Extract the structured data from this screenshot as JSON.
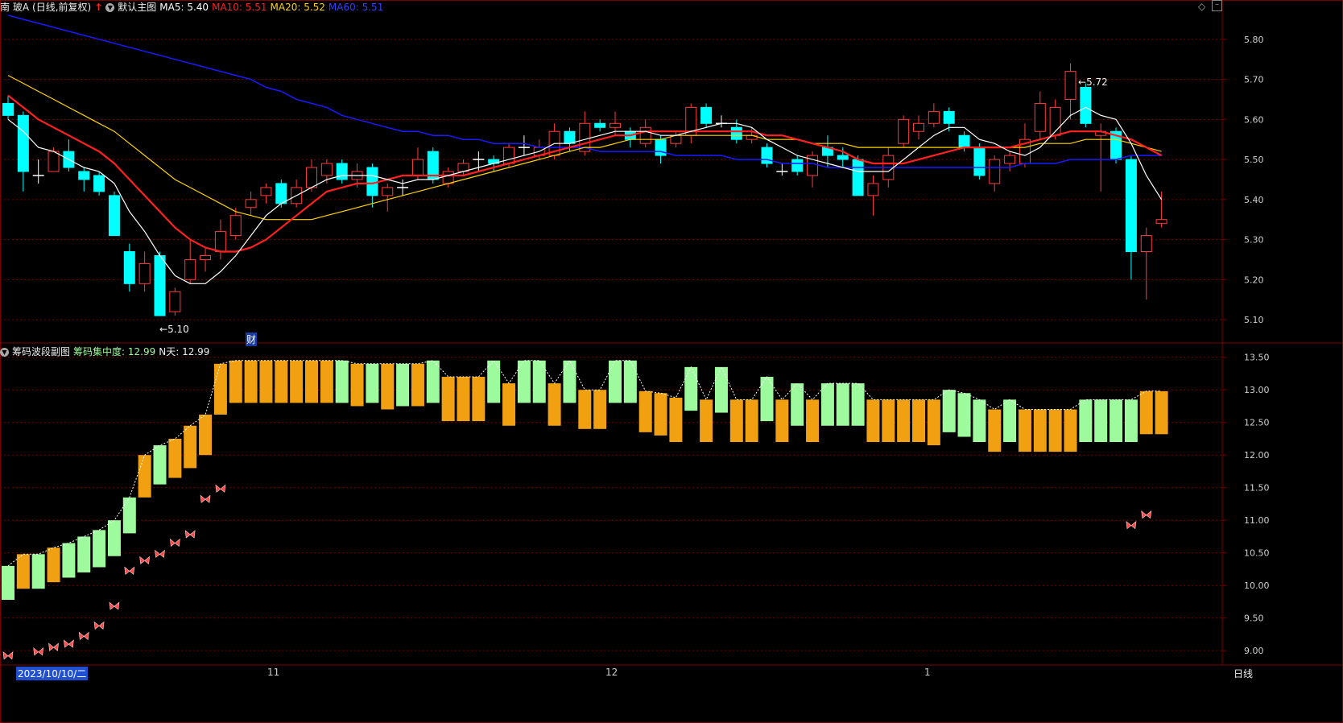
{
  "colors": {
    "up": "#ff3b3b",
    "down": "#00ffff",
    "ma5": "#ffffff",
    "ma10": "#ff2020",
    "ma20": "#ffd400",
    "ma60": "#1a1aff",
    "grid": "#7a0000",
    "chip_up": "#9dfb9d",
    "chip_down": "#f0a010",
    "axis_text": "#d0d0d0"
  },
  "header": {
    "stock": "南 玻A",
    "period": "(日线,前复权)",
    "template": "默认主图",
    "ma5": "MA5: 5.40",
    "ma10": "MA10: 5.51",
    "ma20": "MA20: 5.52",
    "ma60": "MA60: 5.51"
  },
  "sub_header": {
    "name": "筹码波段副图",
    "concentration": "筹码集中度: 12.99",
    "ndays": "N天: 12.99"
  },
  "annotations": {
    "high": "5.72",
    "low": "5.10",
    "fin": "财"
  },
  "xaxis": {
    "labels": [
      "2023/10/10/二",
      "11",
      "12",
      "1"
    ],
    "period_button": "日线"
  },
  "icons": [
    "arrow-up-icon",
    "chevron-down-icon",
    "diamond-icon",
    "minimize-icon"
  ],
  "chart_data": [
    {
      "type": "candlestick",
      "ylim": [
        5.07,
        5.87
      ],
      "yticks": [
        5.1,
        5.2,
        5.3,
        5.4,
        5.5,
        5.6,
        5.7,
        5.8
      ],
      "candles": [
        [
          5.64,
          5.61,
          5.66,
          5.6
        ],
        [
          5.61,
          5.47,
          5.62,
          5.42
        ],
        [
          5.46,
          5.46,
          5.5,
          5.44
        ],
        [
          5.47,
          5.52,
          5.53,
          5.47
        ],
        [
          5.52,
          5.48,
          5.55,
          5.47
        ],
        [
          5.47,
          5.45,
          5.48,
          5.42
        ],
        [
          5.46,
          5.42,
          5.47,
          5.41
        ],
        [
          5.41,
          5.31,
          5.42,
          5.31
        ],
        [
          5.27,
          5.19,
          5.29,
          5.17
        ],
        [
          5.19,
          5.24,
          5.27,
          5.17
        ],
        [
          5.26,
          5.11,
          5.27,
          5.11
        ],
        [
          5.12,
          5.17,
          5.18,
          5.11
        ],
        [
          5.2,
          5.25,
          5.3,
          5.19
        ],
        [
          5.25,
          5.26,
          5.28,
          5.22
        ],
        [
          5.27,
          5.32,
          5.35,
          5.25
        ],
        [
          5.31,
          5.36,
          5.38,
          5.3
        ],
        [
          5.38,
          5.4,
          5.42,
          5.36
        ],
        [
          5.41,
          5.43,
          5.44,
          5.39
        ],
        [
          5.44,
          5.39,
          5.45,
          5.38
        ],
        [
          5.39,
          5.43,
          5.45,
          5.38
        ],
        [
          5.43,
          5.48,
          5.5,
          5.42
        ],
        [
          5.46,
          5.49,
          5.5,
          5.44
        ],
        [
          5.49,
          5.45,
          5.5,
          5.44
        ],
        [
          5.45,
          5.47,
          5.49,
          5.43
        ],
        [
          5.48,
          5.41,
          5.49,
          5.38
        ],
        [
          5.41,
          5.43,
          5.44,
          5.37
        ],
        [
          5.43,
          5.43,
          5.45,
          5.41
        ],
        [
          5.46,
          5.5,
          5.53,
          5.45
        ],
        [
          5.52,
          5.45,
          5.53,
          5.44
        ],
        [
          5.44,
          5.47,
          5.48,
          5.43
        ],
        [
          5.47,
          5.49,
          5.5,
          5.46
        ],
        [
          5.5,
          5.5,
          5.52,
          5.47
        ],
        [
          5.5,
          5.49,
          5.51,
          5.47
        ],
        [
          5.49,
          5.53,
          5.54,
          5.48
        ],
        [
          5.53,
          5.53,
          5.56,
          5.51
        ],
        [
          5.51,
          5.53,
          5.55,
          5.5
        ],
        [
          5.51,
          5.57,
          5.59,
          5.5
        ],
        [
          5.57,
          5.54,
          5.58,
          5.52
        ],
        [
          5.52,
          5.59,
          5.62,
          5.51
        ],
        [
          5.59,
          5.58,
          5.6,
          5.57
        ],
        [
          5.58,
          5.59,
          5.62,
          5.56
        ],
        [
          5.57,
          5.55,
          5.58,
          5.53
        ],
        [
          5.54,
          5.58,
          5.6,
          5.53
        ],
        [
          5.55,
          5.51,
          5.56,
          5.49
        ],
        [
          5.54,
          5.56,
          5.57,
          5.53
        ],
        [
          5.56,
          5.63,
          5.64,
          5.54
        ],
        [
          5.63,
          5.59,
          5.64,
          5.58
        ],
        [
          5.59,
          5.59,
          5.61,
          5.58
        ],
        [
          5.58,
          5.55,
          5.6,
          5.54
        ],
        [
          5.55,
          5.56,
          5.58,
          5.54
        ],
        [
          5.53,
          5.49,
          5.54,
          5.48
        ],
        [
          5.47,
          5.47,
          5.49,
          5.46
        ],
        [
          5.5,
          5.47,
          5.51,
          5.46
        ],
        [
          5.46,
          5.51,
          5.52,
          5.43
        ],
        [
          5.53,
          5.51,
          5.56,
          5.48
        ],
        [
          5.51,
          5.5,
          5.53,
          5.48
        ],
        [
          5.5,
          5.41,
          5.51,
          5.41
        ],
        [
          5.41,
          5.44,
          5.46,
          5.36
        ],
        [
          5.45,
          5.51,
          5.53,
          5.43
        ],
        [
          5.54,
          5.6,
          5.61,
          5.53
        ],
        [
          5.57,
          5.59,
          5.61,
          5.55
        ],
        [
          5.59,
          5.62,
          5.64,
          5.58
        ],
        [
          5.62,
          5.59,
          5.63,
          5.57
        ],
        [
          5.56,
          5.53,
          5.57,
          5.52
        ],
        [
          5.53,
          5.46,
          5.54,
          5.45
        ],
        [
          5.44,
          5.5,
          5.51,
          5.42
        ],
        [
          5.49,
          5.51,
          5.52,
          5.47
        ],
        [
          5.49,
          5.55,
          5.59,
          5.48
        ],
        [
          5.57,
          5.64,
          5.67,
          5.55
        ],
        [
          5.56,
          5.63,
          5.65,
          5.55
        ],
        [
          5.65,
          5.72,
          5.74,
          5.6
        ],
        [
          5.68,
          5.59,
          5.69,
          5.58
        ],
        [
          5.56,
          5.57,
          5.59,
          5.42
        ],
        [
          5.57,
          5.5,
          5.58,
          5.49
        ],
        [
          5.5,
          5.27,
          5.51,
          5.2
        ],
        [
          5.27,
          5.31,
          5.33,
          5.15
        ],
        [
          5.34,
          5.35,
          5.42,
          5.33
        ]
      ],
      "ma5": [
        5.6,
        5.57,
        5.53,
        5.52,
        5.5,
        5.48,
        5.47,
        5.44,
        5.37,
        5.32,
        5.26,
        5.21,
        5.19,
        5.19,
        5.22,
        5.26,
        5.31,
        5.36,
        5.39,
        5.41,
        5.43,
        5.45,
        5.46,
        5.46,
        5.46,
        5.45,
        5.44,
        5.45,
        5.45,
        5.46,
        5.47,
        5.48,
        5.49,
        5.5,
        5.51,
        5.52,
        5.54,
        5.54,
        5.55,
        5.56,
        5.57,
        5.57,
        5.57,
        5.56,
        5.56,
        5.57,
        5.58,
        5.59,
        5.59,
        5.58,
        5.55,
        5.53,
        5.51,
        5.5,
        5.49,
        5.48,
        5.47,
        5.47,
        5.47,
        5.5,
        5.53,
        5.56,
        5.58,
        5.58,
        5.55,
        5.54,
        5.52,
        5.51,
        5.53,
        5.57,
        5.61,
        5.63,
        5.61,
        5.6,
        5.54,
        5.46,
        5.4
      ],
      "ma10": [
        5.66,
        5.63,
        5.6,
        5.58,
        5.56,
        5.54,
        5.52,
        5.49,
        5.45,
        5.41,
        5.37,
        5.33,
        5.3,
        5.28,
        5.27,
        5.27,
        5.28,
        5.3,
        5.33,
        5.36,
        5.39,
        5.42,
        5.43,
        5.44,
        5.44,
        5.45,
        5.46,
        5.46,
        5.46,
        5.46,
        5.46,
        5.47,
        5.48,
        5.49,
        5.5,
        5.51,
        5.52,
        5.53,
        5.54,
        5.55,
        5.56,
        5.56,
        5.57,
        5.57,
        5.57,
        5.57,
        5.57,
        5.57,
        5.57,
        5.57,
        5.56,
        5.56,
        5.55,
        5.54,
        5.53,
        5.52,
        5.5,
        5.49,
        5.49,
        5.49,
        5.5,
        5.51,
        5.52,
        5.53,
        5.53,
        5.53,
        5.53,
        5.54,
        5.55,
        5.56,
        5.57,
        5.57,
        5.57,
        5.56,
        5.55,
        5.53,
        5.51
      ],
      "ma20": [
        5.71,
        5.69,
        5.67,
        5.65,
        5.63,
        5.61,
        5.59,
        5.57,
        5.54,
        5.51,
        5.48,
        5.45,
        5.43,
        5.41,
        5.39,
        5.37,
        5.36,
        5.35,
        5.35,
        5.35,
        5.35,
        5.36,
        5.37,
        5.38,
        5.39,
        5.4,
        5.41,
        5.42,
        5.43,
        5.44,
        5.45,
        5.46,
        5.47,
        5.48,
        5.49,
        5.5,
        5.51,
        5.52,
        5.53,
        5.53,
        5.54,
        5.55,
        5.55,
        5.55,
        5.56,
        5.56,
        5.56,
        5.56,
        5.56,
        5.56,
        5.55,
        5.55,
        5.55,
        5.54,
        5.54,
        5.54,
        5.53,
        5.53,
        5.53,
        5.53,
        5.53,
        5.53,
        5.53,
        5.53,
        5.53,
        5.53,
        5.53,
        5.53,
        5.54,
        5.54,
        5.54,
        5.55,
        5.55,
        5.55,
        5.54,
        5.53,
        5.52
      ],
      "ma60": [
        5.86,
        5.85,
        5.84,
        5.83,
        5.82,
        5.81,
        5.8,
        5.79,
        5.78,
        5.77,
        5.76,
        5.75,
        5.74,
        5.73,
        5.72,
        5.71,
        5.7,
        5.68,
        5.67,
        5.65,
        5.64,
        5.63,
        5.61,
        5.6,
        5.59,
        5.58,
        5.57,
        5.57,
        5.56,
        5.56,
        5.55,
        5.55,
        5.54,
        5.54,
        5.54,
        5.53,
        5.53,
        5.53,
        5.53,
        5.52,
        5.52,
        5.52,
        5.52,
        5.52,
        5.51,
        5.51,
        5.51,
        5.51,
        5.5,
        5.5,
        5.5,
        5.49,
        5.49,
        5.49,
        5.48,
        5.48,
        5.48,
        5.48,
        5.48,
        5.48,
        5.48,
        5.48,
        5.48,
        5.48,
        5.48,
        5.48,
        5.48,
        5.49,
        5.49,
        5.49,
        5.5,
        5.5,
        5.5,
        5.5,
        5.51,
        5.51,
        5.51
      ]
    },
    {
      "type": "bar",
      "ylim": [
        8.78,
        13.62
      ],
      "yticks": [
        9.0,
        9.5,
        10.0,
        10.5,
        11.0,
        11.5,
        12.0,
        12.5,
        13.0,
        13.5
      ],
      "bars": [
        [
          9.78,
          10.3,
          1
        ],
        [
          9.95,
          10.48,
          0
        ],
        [
          9.95,
          10.48,
          1
        ],
        [
          10.05,
          10.58,
          0
        ],
        [
          10.12,
          10.65,
          1
        ],
        [
          10.2,
          10.75,
          1
        ],
        [
          10.28,
          10.85,
          1
        ],
        [
          10.45,
          11.0,
          1
        ],
        [
          10.8,
          11.35,
          1
        ],
        [
          11.35,
          12.0,
          0
        ],
        [
          11.55,
          12.15,
          1
        ],
        [
          11.65,
          12.25,
          0
        ],
        [
          11.8,
          12.45,
          0
        ],
        [
          12.0,
          12.62,
          0
        ],
        [
          12.62,
          13.4,
          0
        ],
        [
          12.8,
          13.45,
          0
        ],
        [
          12.8,
          13.45,
          0
        ],
        [
          12.8,
          13.45,
          0
        ],
        [
          12.8,
          13.45,
          0
        ],
        [
          12.8,
          13.45,
          0
        ],
        [
          12.8,
          13.45,
          0
        ],
        [
          12.8,
          13.45,
          0
        ],
        [
          12.8,
          13.45,
          1
        ],
        [
          12.75,
          13.4,
          0
        ],
        [
          12.8,
          13.4,
          1
        ],
        [
          12.7,
          13.4,
          0
        ],
        [
          12.75,
          13.4,
          1
        ],
        [
          12.75,
          13.4,
          0
        ],
        [
          12.8,
          13.45,
          1
        ],
        [
          12.52,
          13.2,
          0
        ],
        [
          12.52,
          13.2,
          0
        ],
        [
          12.52,
          13.2,
          0
        ],
        [
          12.8,
          13.45,
          1
        ],
        [
          12.45,
          13.1,
          0
        ],
        [
          12.8,
          13.45,
          1
        ],
        [
          12.8,
          13.45,
          1
        ],
        [
          12.45,
          13.1,
          0
        ],
        [
          12.8,
          13.45,
          1
        ],
        [
          12.4,
          13.0,
          0
        ],
        [
          12.4,
          13.0,
          0
        ],
        [
          12.8,
          13.45,
          1
        ],
        [
          12.8,
          13.45,
          1
        ],
        [
          12.35,
          12.98,
          0
        ],
        [
          12.3,
          12.95,
          0
        ],
        [
          12.2,
          12.88,
          0
        ],
        [
          12.68,
          13.35,
          1
        ],
        [
          12.2,
          12.85,
          0
        ],
        [
          12.65,
          13.35,
          1
        ],
        [
          12.2,
          12.85,
          0
        ],
        [
          12.2,
          12.85,
          0
        ],
        [
          12.52,
          13.2,
          1
        ],
        [
          12.2,
          12.85,
          0
        ],
        [
          12.45,
          13.1,
          1
        ],
        [
          12.2,
          12.85,
          0
        ],
        [
          12.45,
          13.1,
          1
        ],
        [
          12.45,
          13.1,
          1
        ],
        [
          12.45,
          13.1,
          1
        ],
        [
          12.2,
          12.85,
          0
        ],
        [
          12.2,
          12.85,
          0
        ],
        [
          12.2,
          12.85,
          0
        ],
        [
          12.2,
          12.85,
          0
        ],
        [
          12.15,
          12.85,
          0
        ],
        [
          12.35,
          13.0,
          1
        ],
        [
          12.28,
          12.95,
          1
        ],
        [
          12.2,
          12.85,
          1
        ],
        [
          12.05,
          12.7,
          0
        ],
        [
          12.2,
          12.85,
          1
        ],
        [
          12.05,
          12.7,
          0
        ],
        [
          12.05,
          12.7,
          0
        ],
        [
          12.05,
          12.7,
          0
        ],
        [
          12.05,
          12.7,
          0
        ],
        [
          12.2,
          12.85,
          1
        ],
        [
          12.2,
          12.85,
          1
        ],
        [
          12.2,
          12.85,
          1
        ],
        [
          12.2,
          12.85,
          1
        ],
        [
          12.32,
          12.98,
          0
        ],
        [
          12.32,
          12.98,
          0
        ]
      ],
      "markers": [
        [
          0,
          8.92
        ],
        [
          2,
          8.98
        ],
        [
          3,
          9.05
        ],
        [
          4,
          9.1
        ],
        [
          5,
          9.22
        ],
        [
          6,
          9.38
        ],
        [
          7,
          9.68
        ],
        [
          8,
          10.22
        ],
        [
          9,
          10.38
        ],
        [
          10,
          10.48
        ],
        [
          11,
          10.65
        ],
        [
          12,
          10.78
        ],
        [
          13,
          11.32
        ],
        [
          14,
          11.48
        ],
        [
          74,
          10.92
        ],
        [
          75,
          11.08
        ]
      ]
    }
  ]
}
